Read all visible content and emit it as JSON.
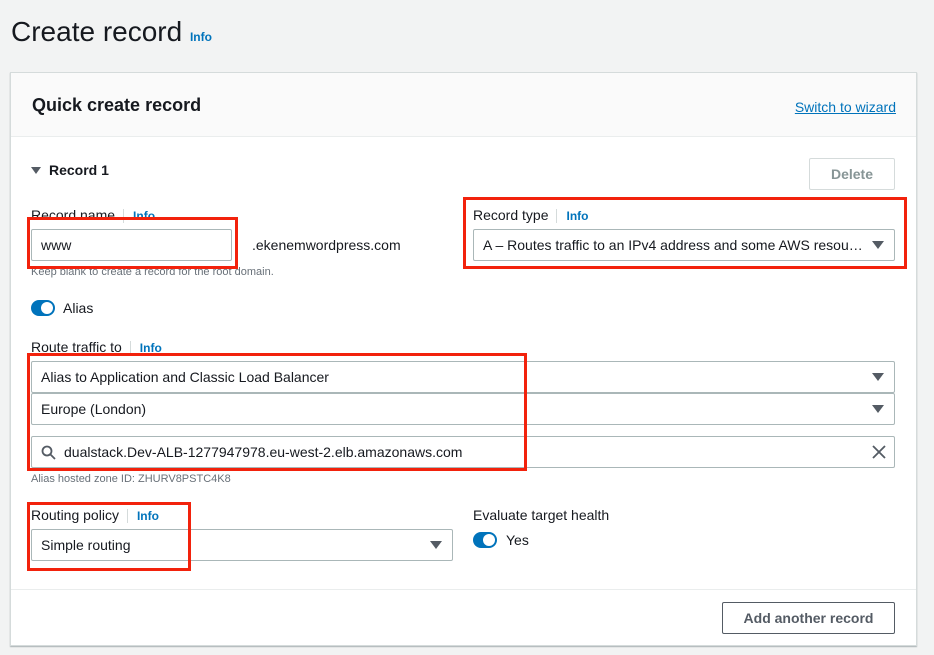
{
  "page": {
    "title": "Create record",
    "info": "Info"
  },
  "card": {
    "title": "Quick create record",
    "switch_link": "Switch to wizard"
  },
  "record": {
    "title": "Record 1",
    "delete": "Delete",
    "name_label": "Record name",
    "name_info": "Info",
    "name_value": "www",
    "domain_suffix": ".ekenemwordpress.com",
    "name_hint": "Keep blank to create a record for the root domain.",
    "type_label": "Record type",
    "type_info": "Info",
    "type_value": "A – Routes traffic to an IPv4 address and some AWS resou…",
    "alias_label": "Alias",
    "alias_on": true,
    "route_label": "Route traffic to",
    "route_info": "Info",
    "endpoint_value": "Alias to Application and Classic Load Balancer",
    "region_value": "Europe (London)",
    "lb_value": "dualstack.Dev-ALB-1277947978.eu-west-2.elb.amazonaws.com",
    "zone_hint": "Alias hosted zone ID: ZHURV8PSTC4K8",
    "policy_label": "Routing policy",
    "policy_info": "Info",
    "policy_value": "Simple routing",
    "health_label": "Evaluate target health",
    "health_value": "Yes",
    "health_on": true
  },
  "footer": {
    "add": "Add another record"
  },
  "colors": {
    "accent": "#0073bb",
    "highlight": "#f2220c"
  }
}
